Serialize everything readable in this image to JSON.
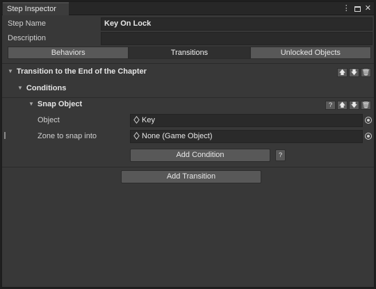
{
  "window": {
    "tab_title": "Step Inspector",
    "icons": [
      "kebab-menu-icon",
      "maximize-icon",
      "close-icon"
    ],
    "menu_glyph": "⋮",
    "close_glyph": "✕"
  },
  "step": {
    "name_label": "Step Name",
    "name_value": "Key On Lock",
    "description_label": "Description",
    "description_value": ""
  },
  "tabs": [
    {
      "label": "Behaviors",
      "active": false
    },
    {
      "label": "Transitions",
      "active": true
    },
    {
      "label": "Unlocked Objects",
      "active": false
    }
  ],
  "transition": {
    "title": "Transition to the End of the Chapter",
    "buttons": [
      "move-up-icon",
      "move-down-icon",
      "delete-icon"
    ],
    "conditions_title": "Conditions",
    "condition": {
      "title": "Snap Object",
      "help": "?",
      "object_label": "Object",
      "object_value": "Key",
      "zone_label": "Zone to snap into",
      "zone_value": "None (Game Object)"
    },
    "add_condition": "Add Condition",
    "add_condition_help": "?"
  },
  "add_transition": "Add Transition",
  "colors": {
    "background": "#383838",
    "field": "#2a2a2a",
    "button": "#585858",
    "active_tab": "#2f2f2f"
  }
}
